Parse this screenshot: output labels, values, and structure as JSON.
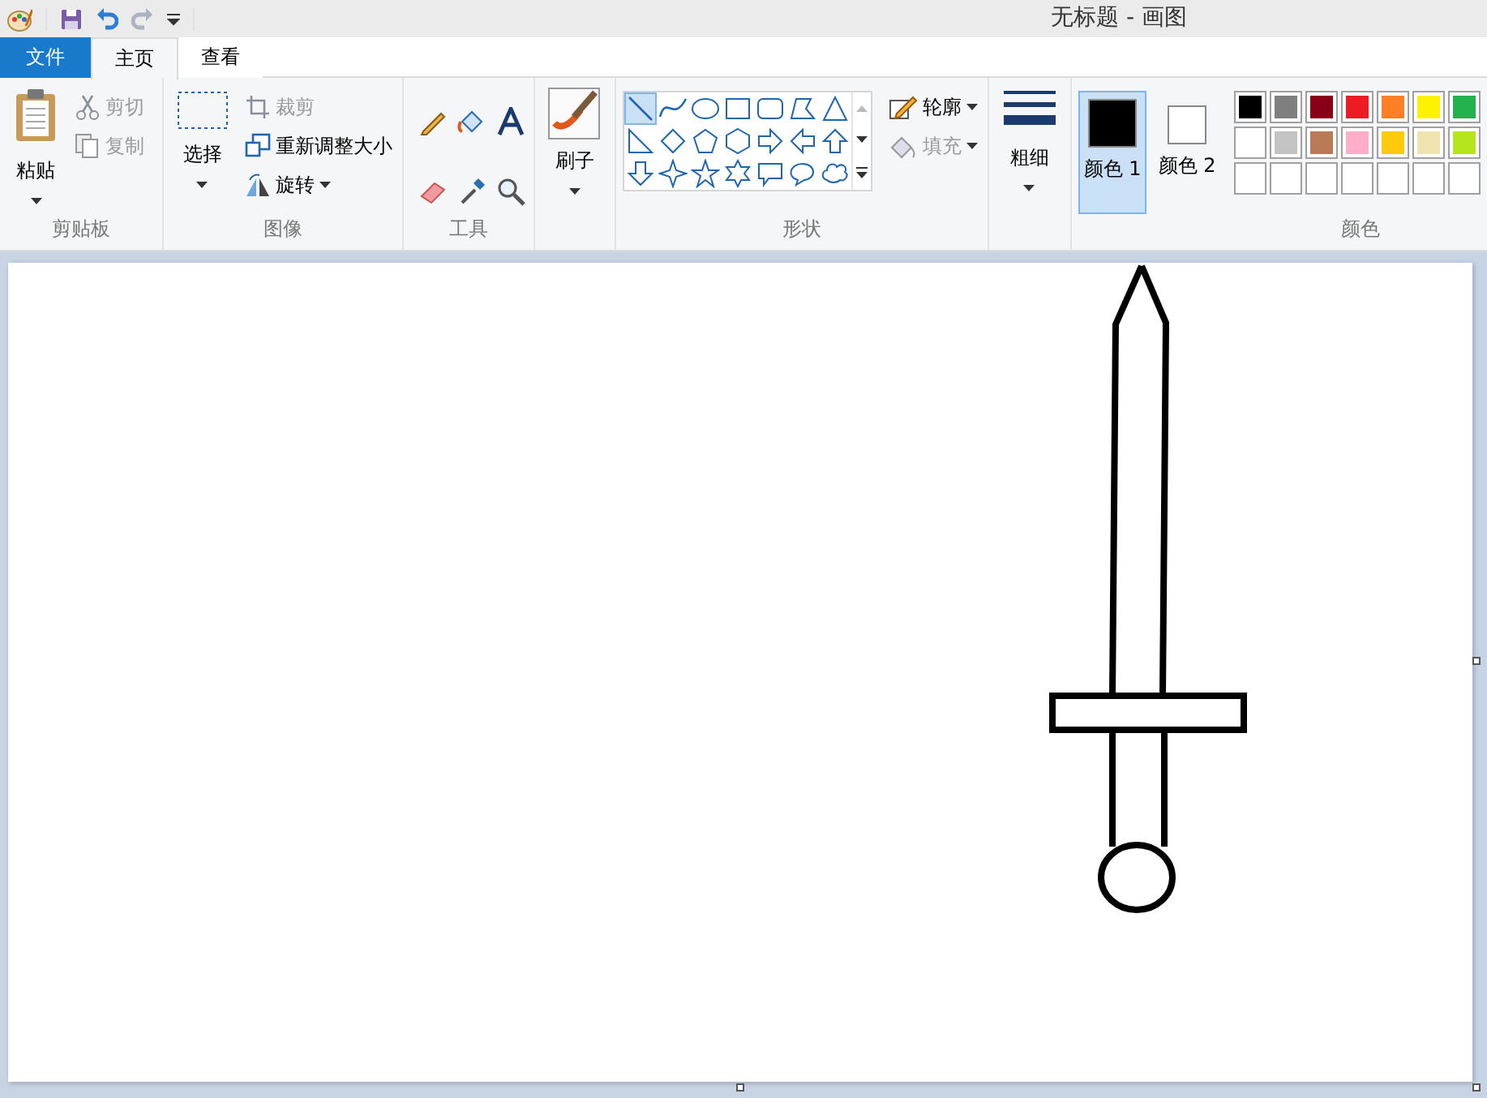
{
  "window": {
    "title": "无标题 - 画图"
  },
  "tabs": [
    {
      "label": "文件",
      "kind": "file",
      "selected": false
    },
    {
      "label": "主页",
      "kind": "tab",
      "selected": true
    },
    {
      "label": "查看",
      "kind": "tab",
      "selected": false
    }
  ],
  "clipboard": {
    "label": "剪贴板",
    "paste": "粘贴",
    "items": [
      {
        "label": "剪切",
        "kind": "scissors",
        "disabled": true
      },
      {
        "label": "复制",
        "kind": "copy",
        "disabled": true
      }
    ]
  },
  "image": {
    "label": "图像",
    "select": "选择",
    "items": [
      {
        "label": "裁剪",
        "kind": "crop",
        "disabled": true,
        "dropdown": false
      },
      {
        "label": "重新调整大小",
        "kind": "resize",
        "disabled": false,
        "dropdown": false
      },
      {
        "label": "旋转",
        "kind": "rotate",
        "disabled": false,
        "dropdown": true
      }
    ]
  },
  "tools": {
    "label": "工具"
  },
  "brushes": {
    "label": "刷子"
  },
  "shapes": {
    "label": "形状",
    "items": [
      {
        "kind": "line",
        "selected": true
      },
      {
        "kind": "curve",
        "selected": false
      },
      {
        "kind": "oval",
        "selected": false
      },
      {
        "kind": "rectangle",
        "selected": false
      },
      {
        "kind": "rounded-rectangle",
        "selected": false
      },
      {
        "kind": "polygon",
        "selected": false
      },
      {
        "kind": "triangle",
        "selected": false
      },
      {
        "kind": "right-triangle",
        "selected": false
      },
      {
        "kind": "diamond",
        "selected": false
      },
      {
        "kind": "pentagon",
        "selected": false
      },
      {
        "kind": "hexagon",
        "selected": false
      },
      {
        "kind": "arrow-right",
        "selected": false
      },
      {
        "kind": "arrow-left",
        "selected": false
      },
      {
        "kind": "arrow-up",
        "selected": false
      },
      {
        "kind": "arrow-down",
        "selected": false
      },
      {
        "kind": "star4",
        "selected": false
      },
      {
        "kind": "star5",
        "selected": false
      },
      {
        "kind": "star6",
        "selected": false
      },
      {
        "kind": "callout-rect",
        "selected": false
      },
      {
        "kind": "callout-oval",
        "selected": false
      },
      {
        "kind": "callout-cloud",
        "selected": false
      }
    ],
    "options": [
      {
        "label": "轮廓",
        "kind": "outline",
        "disabled": false
      },
      {
        "label": "填充",
        "kind": "fill",
        "disabled": true
      }
    ]
  },
  "size": {
    "label": "粗细"
  },
  "colors": {
    "label": "颜色",
    "slots": [
      {
        "label": "颜色 1",
        "color": "#000000",
        "selected": true
      },
      {
        "label": "颜色 2",
        "color": "#ffffff",
        "selected": false
      }
    ],
    "palette": [
      {
        "color": "#000000"
      },
      {
        "color": "#7f7f7f"
      },
      {
        "color": "#880015"
      },
      {
        "color": "#ed1c24"
      },
      {
        "color": "#ff7f27"
      },
      {
        "color": "#fff200"
      },
      {
        "color": "#22b14c"
      },
      {
        "color": "#ffffff"
      },
      {
        "color": "#c3c3c3"
      },
      {
        "color": "#b97a57"
      },
      {
        "color": "#ffaec9"
      },
      {
        "color": "#ffc90e"
      },
      {
        "color": "#efe4b0"
      },
      {
        "color": "#b5e61d"
      }
    ]
  }
}
